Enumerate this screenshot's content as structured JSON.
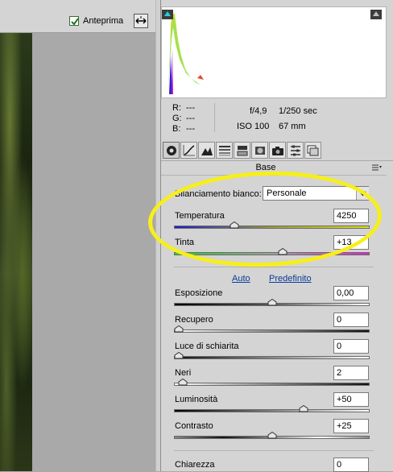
{
  "preview": {
    "label": "Anteprima",
    "checked": true
  },
  "info": {
    "r_label": "R:",
    "r_value": "---",
    "g_label": "G:",
    "g_value": "---",
    "b_label": "B:",
    "b_value": "---",
    "aperture": "f/4,9",
    "shutter": "1/250 sec",
    "iso": "ISO 100",
    "focal": "67 mm"
  },
  "tabs": [
    "basic-icon",
    "tone-curve-icon",
    "detail-icon",
    "hsl-icon",
    "split-toning-icon",
    "lens-icon",
    "camera-calibration-icon",
    "presets-icon",
    "snapshots-icon"
  ],
  "section": {
    "title": "Base"
  },
  "white_balance": {
    "label": "Bilanciamento bianco:",
    "value": "Personale"
  },
  "temperature": {
    "label": "Temperatura",
    "value": "4250",
    "level": 0.3
  },
  "tint": {
    "label": "Tinta",
    "value": "+13",
    "level": 0.56
  },
  "links": {
    "auto": "Auto",
    "default": "Predefinito"
  },
  "exposure": {
    "label": "Esposizione",
    "value": "0,00",
    "level": 0.5
  },
  "recovery": {
    "label": "Recupero",
    "value": "0",
    "level": 0.0
  },
  "fill_light": {
    "label": "Luce di schiarita",
    "value": "0",
    "level": 0.0
  },
  "blacks": {
    "label": "Neri",
    "value": "2",
    "level": 0.02
  },
  "brightness": {
    "label": "Luminosità",
    "value": "+50",
    "level": 0.67
  },
  "contrast": {
    "label": "Contrasto",
    "value": "+25",
    "level": 0.5
  },
  "clarity": {
    "label": "Chiarezza",
    "value": "0"
  },
  "colors": {
    "highlight": "#f7ef1a",
    "link": "#0a3a9a",
    "panel": "#d4d4d4"
  }
}
